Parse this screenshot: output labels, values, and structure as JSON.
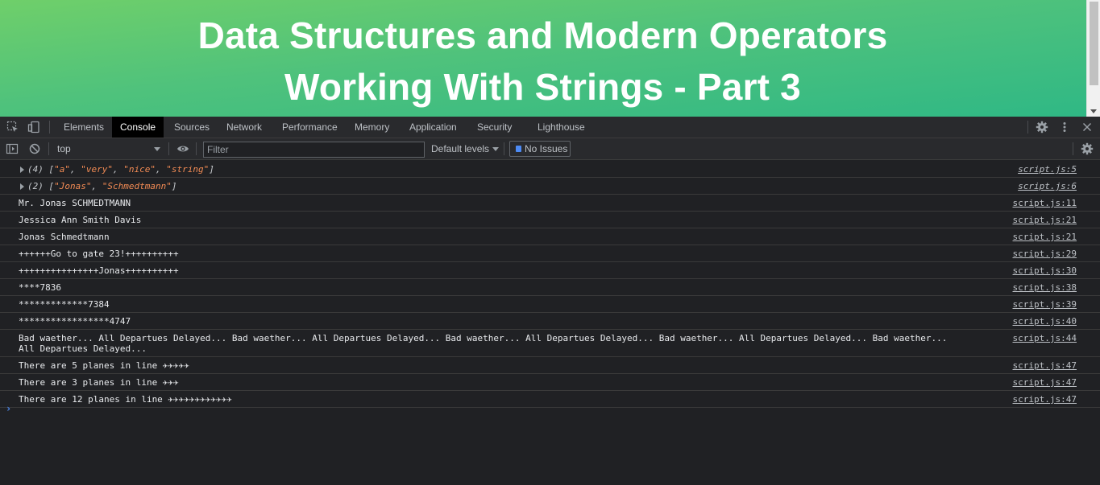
{
  "page": {
    "title_line1": "Data Structures and Modern Operators",
    "title_line2": "Working With Strings - Part 3",
    "gradient_start": "#6fcf6a",
    "gradient_end": "#2fb885"
  },
  "devtools": {
    "tabs": [
      {
        "label": "Elements",
        "active": false
      },
      {
        "label": "Console",
        "active": true
      },
      {
        "label": "Sources",
        "active": false
      },
      {
        "label": "Network",
        "active": false
      },
      {
        "label": "Performance",
        "active": false
      },
      {
        "label": "Memory",
        "active": false
      },
      {
        "label": "Application",
        "active": false
      },
      {
        "label": "Security",
        "active": false
      },
      {
        "label": "Lighthouse",
        "active": false
      }
    ],
    "icons": {
      "inspect": "inspect-element-icon",
      "device": "device-toolbar-icon",
      "settings": "gear-icon",
      "more": "more-vertical-icon",
      "close": "close-icon"
    },
    "toolbar": {
      "context": "top",
      "filter_placeholder": "Filter",
      "filter_value": "",
      "levels_label": "Default levels",
      "issues_label": "No Issues"
    },
    "console": {
      "obj_rows": [
        {
          "count": "(4)",
          "items": [
            "\"a\"",
            "\"very\"",
            "\"nice\"",
            "\"string\""
          ],
          "source": "script.js:5"
        },
        {
          "count": "(2)",
          "items": [
            "\"Jonas\"",
            "\"Schmedtmann\""
          ],
          "source": "script.js:6"
        }
      ],
      "rows": [
        {
          "text": "Mr. Jonas SCHMEDTMANN",
          "source": "script.js:11"
        },
        {
          "text": "Jessica Ann Smith Davis",
          "source": "script.js:21"
        },
        {
          "text": "Jonas Schmedtmann",
          "source": "script.js:21"
        },
        {
          "text": "++++++Go to gate 23!++++++++++",
          "source": "script.js:29"
        },
        {
          "text": "+++++++++++++++Jonas++++++++++",
          "source": "script.js:30"
        },
        {
          "text": "****7836",
          "source": "script.js:38"
        },
        {
          "text": "*************7384",
          "source": "script.js:39"
        },
        {
          "text": "*****************4747",
          "source": "script.js:40"
        },
        {
          "text": "Bad waether... All Departues Delayed... Bad waether... All Departues Delayed... Bad waether... All Departues Delayed... Bad waether... All Departues Delayed... Bad waether... All Departues Delayed...",
          "source": "script.js:44"
        },
        {
          "text": "There are 5 planes in line ✈✈✈✈✈",
          "source": "script.js:47"
        },
        {
          "text": "There are 3 planes in line ✈✈✈",
          "source": "script.js:47"
        },
        {
          "text": "There are 12 planes in line ✈✈✈✈✈✈✈✈✈✈✈✈",
          "source": "script.js:47"
        }
      ]
    }
  }
}
